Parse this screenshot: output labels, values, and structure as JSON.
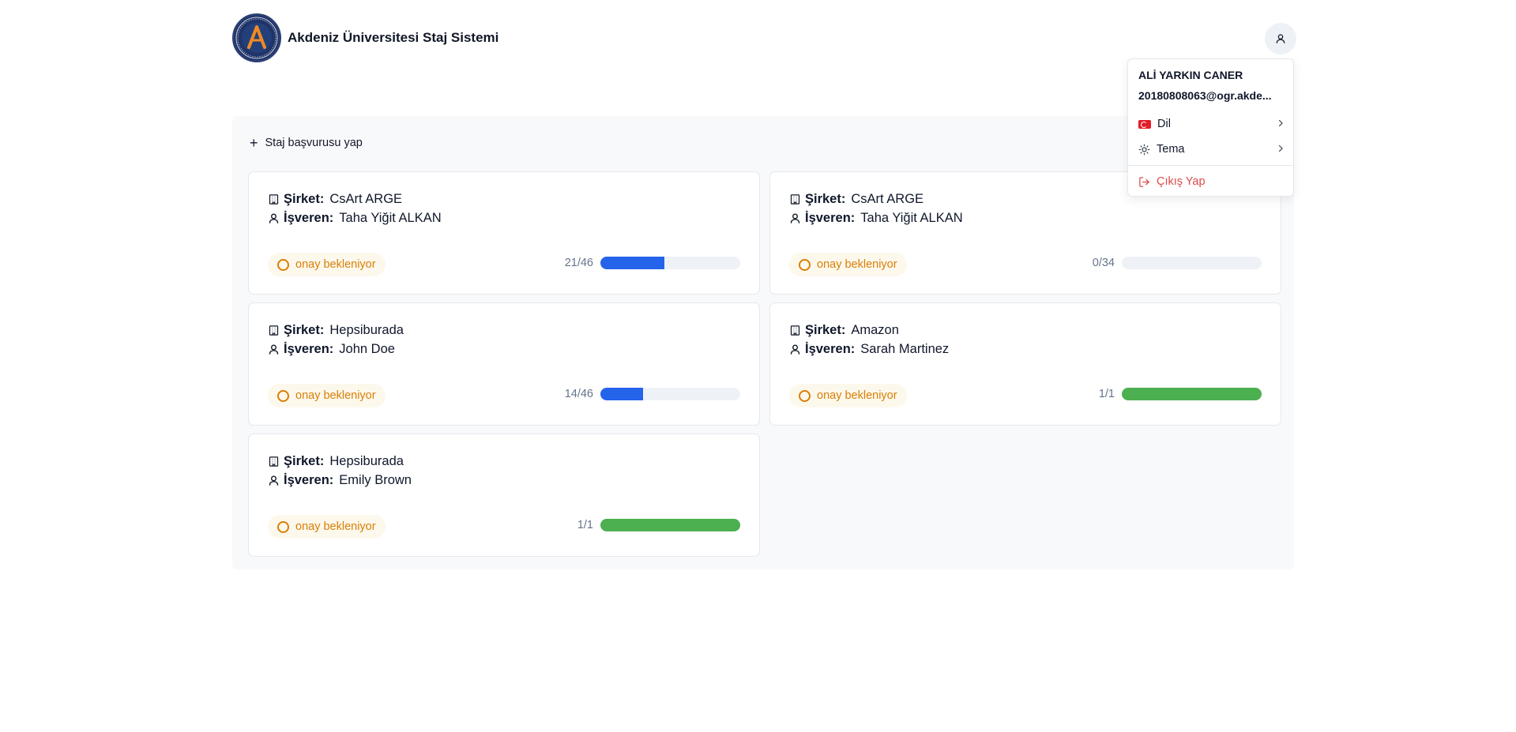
{
  "app": {
    "title": "Akdeniz Üniversitesi Staj Sistemi"
  },
  "colors": {
    "progress_blue": "#2563eb",
    "progress_green": "#4caf50",
    "pending": "#d97f06",
    "danger": "#dc4a4a"
  },
  "main": {
    "apply_label": "Staj başvurusu yap"
  },
  "labels": {
    "company": "Şirket:",
    "employer": "İşveren:"
  },
  "applications": [
    {
      "company": "CsArt ARGE",
      "employer": "Taha Yiğit ALKAN",
      "status": "onay bekleniyor",
      "progress": "21/46",
      "fraction": 0.4565,
      "color": "#2563eb"
    },
    {
      "company": "CsArt ARGE",
      "employer": "Taha Yiğit ALKAN",
      "status": "onay bekleniyor",
      "progress": "0/34",
      "fraction": 0,
      "color": "#2563eb"
    },
    {
      "company": "Hepsiburada",
      "employer": "John Doe",
      "status": "onay bekleniyor",
      "progress": "14/46",
      "fraction": 0.3043,
      "color": "#2563eb"
    },
    {
      "company": "Amazon",
      "employer": "Sarah Martinez",
      "status": "onay bekleniyor",
      "progress": "1/1",
      "fraction": 1,
      "color": "#4caf50"
    },
    {
      "company": "Hepsiburada",
      "employer": "Emily Brown",
      "status": "onay bekleniyor",
      "progress": "1/1",
      "fraction": 1,
      "color": "#4caf50"
    }
  ],
  "user_menu": {
    "name": "ALİ YARKIN CANER",
    "email": "20180808063@ogr.akde...",
    "language_label": "Dil",
    "theme_label": "Tema",
    "logout_label": "Çıkış Yap"
  },
  "icons": {
    "user_button": "user-icon",
    "apply": "plus-icon",
    "company": "building-icon",
    "employer": "user-icon",
    "status": "circle-icon",
    "language": "turkey-flag-icon",
    "theme": "sun-icon",
    "logout": "logout-icon",
    "submenu": "chevron-right-icon"
  }
}
